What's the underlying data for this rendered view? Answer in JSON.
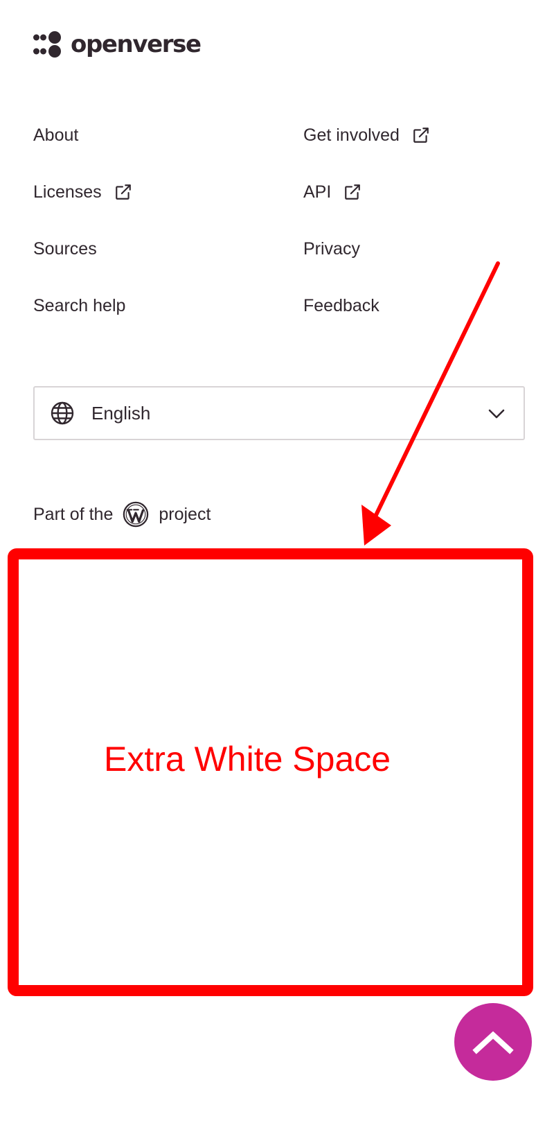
{
  "brand": {
    "name": "openverse",
    "text_color": "#30272e"
  },
  "nav": {
    "left": [
      {
        "label": "About",
        "external": false
      },
      {
        "label": "Licenses",
        "external": true
      },
      {
        "label": "Sources",
        "external": false
      },
      {
        "label": "Search help",
        "external": false
      }
    ],
    "right": [
      {
        "label": "Get involved",
        "external": true
      },
      {
        "label": "API",
        "external": true
      },
      {
        "label": "Privacy",
        "external": false
      },
      {
        "label": "Feedback",
        "external": false
      }
    ]
  },
  "language_select": {
    "icon": "globe-icon",
    "selected": "English",
    "chevron": "chevron-down-icon"
  },
  "footer": {
    "part_of_prefix": "Part of the",
    "part_of_icon": "wordpress-icon",
    "part_of_suffix": "project"
  },
  "annotation": {
    "label": "Extra White Space",
    "color": "#ff0000"
  },
  "back_to_top": {
    "icon": "chevron-up-icon",
    "color": "#c52b9b"
  }
}
